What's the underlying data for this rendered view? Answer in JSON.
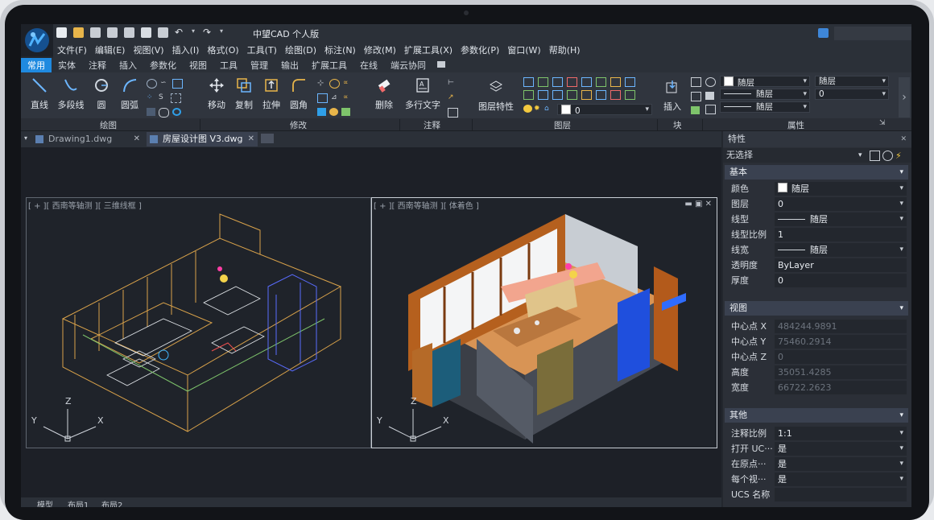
{
  "app": {
    "title": "中望CAD 个人版"
  },
  "menu": [
    "文件(F)",
    "编辑(E)",
    "视图(V)",
    "插入(I)",
    "格式(O)",
    "工具(T)",
    "绘图(D)",
    "标注(N)",
    "修改(M)",
    "扩展工具(X)",
    "参数化(P)",
    "窗口(W)",
    "帮助(H)"
  ],
  "ribbon_tabs": [
    "常用",
    "实体",
    "注释",
    "插入",
    "参数化",
    "视图",
    "工具",
    "管理",
    "输出",
    "扩展工具",
    "在线",
    "端云协同"
  ],
  "ribbon": {
    "draw": {
      "line": "直线",
      "polyline": "多段线",
      "circle": "圆",
      "arc": "圆弧",
      "group": "绘图"
    },
    "modify": {
      "move": "移动",
      "copy": "复制",
      "stretch": "拉伸",
      "fillet": "圆角",
      "delete": "删除",
      "group": "修改"
    },
    "annotate": {
      "mtext": "多行文字",
      "group": "注释"
    },
    "layer": {
      "props": "图层特性",
      "current": "0",
      "group": "图层"
    },
    "block": {
      "insert": "插入",
      "group": "块"
    },
    "properties": {
      "color": "随层",
      "layer_box": "随层",
      "linetype": "随层",
      "lineweight": "随层",
      "value": "0",
      "group": "属性"
    }
  },
  "doc_tabs": [
    {
      "name": "Drawing1.dwg",
      "active": false
    },
    {
      "name": "房屋设计图 V3.dwg",
      "active": true
    }
  ],
  "viewports": [
    {
      "label": "[ + ][ 西南等轴测 ][ 三维线框 ]"
    },
    {
      "label": "[ + ][ 西南等轴测 ][ 体着色 ]"
    }
  ],
  "axis": {
    "x": "X",
    "y": "Y",
    "z": "Z"
  },
  "properties_panel": {
    "title": "特性",
    "selection": "无选择",
    "basic": {
      "header": "基本",
      "rows": [
        {
          "k": "颜色",
          "v": "随层"
        },
        {
          "k": "图层",
          "v": "0"
        },
        {
          "k": "线型",
          "v": "随层"
        },
        {
          "k": "线型比例",
          "v": "1"
        },
        {
          "k": "线宽",
          "v": "随层"
        },
        {
          "k": "透明度",
          "v": "ByLayer"
        },
        {
          "k": "厚度",
          "v": "0"
        }
      ]
    },
    "view": {
      "header": "视图",
      "rows": [
        {
          "k": "中心点 X",
          "v": "484244.9891"
        },
        {
          "k": "中心点 Y",
          "v": "75460.2914"
        },
        {
          "k": "中心点 Z",
          "v": "0"
        },
        {
          "k": "高度",
          "v": "35051.4285"
        },
        {
          "k": "宽度",
          "v": "66722.2623"
        }
      ]
    },
    "other": {
      "header": "其他",
      "rows": [
        {
          "k": "注释比例",
          "v": "1:1"
        },
        {
          "k": "打开 UC···",
          "v": "是"
        },
        {
          "k": "在原点···",
          "v": "是"
        },
        {
          "k": "每个视···",
          "v": "是"
        },
        {
          "k": "UCS 名称",
          "v": ""
        }
      ]
    }
  },
  "layout_tabs": [
    "模型",
    "布局1",
    "布局2"
  ],
  "colors": {
    "accent": "#1f8ae0",
    "background": "#1f232a"
  }
}
